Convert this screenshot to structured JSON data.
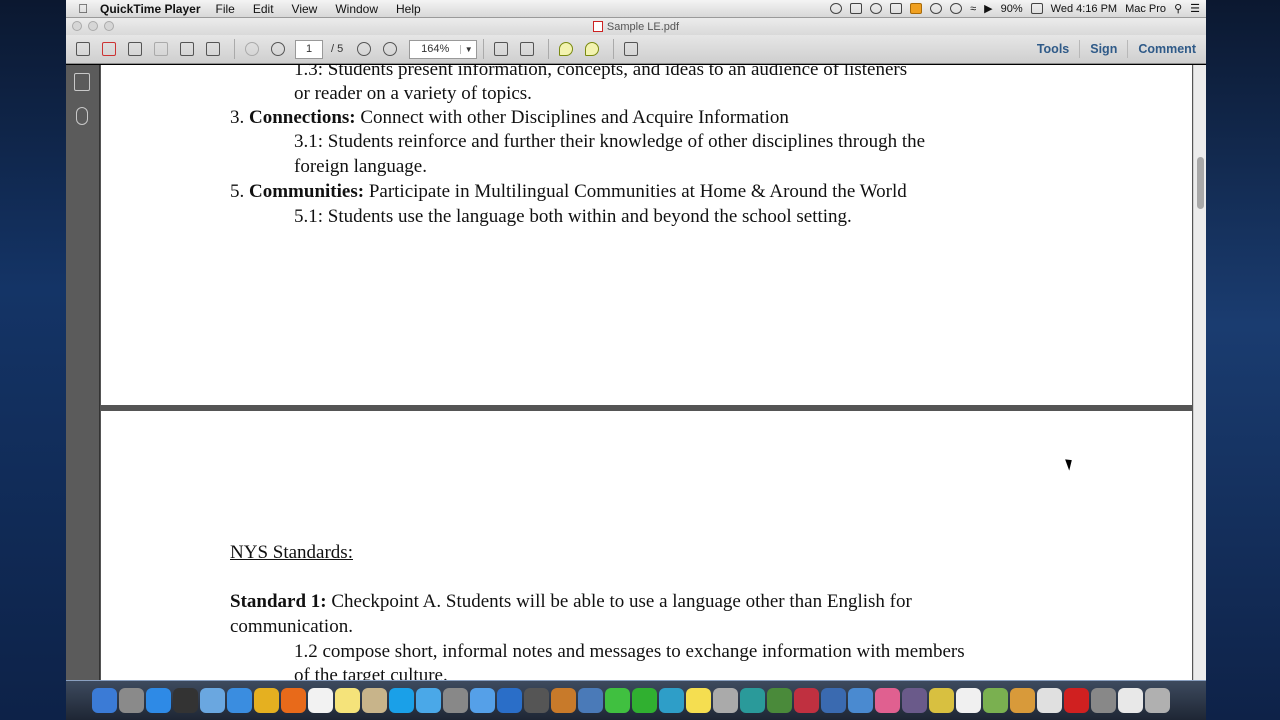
{
  "menubar": {
    "app_name": "QuickTime Player",
    "menus": [
      "File",
      "Edit",
      "View",
      "Window",
      "Help"
    ],
    "battery": "90%",
    "clock": "Wed 4:16 PM",
    "user": "Mac Pro"
  },
  "window": {
    "title": "Sample LE.pdf"
  },
  "toolbar": {
    "page_current": "1",
    "page_total": "/ 5",
    "zoom": "164%",
    "tools_label": "Tools",
    "sign_label": "Sign",
    "comment_label": "Comment"
  },
  "document": {
    "page1": {
      "line1": "1.3: Students present information, concepts, and ideas to an audience of listeners",
      "line2": "or reader on a variety of topics.",
      "item3_num": "3. ",
      "item3_bold": "Connections:",
      "item3_text": " Connect with other Disciplines and Acquire Information",
      "line4": "3.1: Students reinforce and further their knowledge of other disciplines through the",
      "line5": "foreign language.",
      "item5_num": "5. ",
      "item5_bold": "Communities:",
      "item5_text": " Participate in Multilingual Communities at Home & Around the World",
      "line7": "5.1: Students use the language both within and beyond the school setting."
    },
    "page2": {
      "heading": "NYS Standards:",
      "std_bold": "Standard 1:",
      "std_text": " Checkpoint A. Students will be able to use a language other than English for",
      "std_cont": "communication.",
      "line_a": "1.2 compose short, informal notes and messages to exchange information with members",
      "line_b": "of the target culture."
    }
  },
  "dock": {
    "icons": [
      "finder-icon",
      "launchpad-icon",
      "app-store-icon",
      "dashboard-icon",
      "preview-icon",
      "safari-icon",
      "chrome-icon",
      "firefox-icon",
      "calendar-icon",
      "notes-icon",
      "contacts-icon",
      "skype-icon",
      "itunes-icon",
      "image-capture-icon",
      "messages-icon",
      "globe-icon",
      "utility-icon",
      "garageband-icon",
      "iphoto-icon",
      "app-icon",
      "spotify-icon",
      "app-icon",
      "stickies-icon",
      "app-icon",
      "timemachine-icon",
      "app-icon",
      "app-icon",
      "app-icon",
      "app-icon",
      "app-icon",
      "app-icon",
      "app-icon",
      "app-icon",
      "app-icon",
      "app-icon",
      "app-icon",
      "acrobat-icon",
      "app-icon",
      "mail-icon",
      "trash-icon"
    ],
    "colors": [
      "#3b7bd6",
      "#8a8a8a",
      "#2e8ae6",
      "#333333",
      "#6aa7e0",
      "#3a8de0",
      "#e5b020",
      "#e86a1a",
      "#f2f2f2",
      "#f5e37a",
      "#c8b48a",
      "#1aa0e8",
      "#4aa8e8",
      "#888888",
      "#55a0e8",
      "#2a6ec8",
      "#555555",
      "#c87a2a",
      "#4a7ab8",
      "#40c040",
      "#30b030",
      "#2e9ec8",
      "#f5de50",
      "#aaaaaa",
      "#2a9a9a",
      "#4a8a3a",
      "#c03040",
      "#3a6ab0",
      "#4a8ad0",
      "#e06090",
      "#6a5a8a",
      "#d8c040",
      "#f0f0f0",
      "#7ab050",
      "#d89a3a",
      "#e0e0e0",
      "#d02020",
      "#888888",
      "#e8e8e8",
      "#b0b0b0"
    ]
  }
}
